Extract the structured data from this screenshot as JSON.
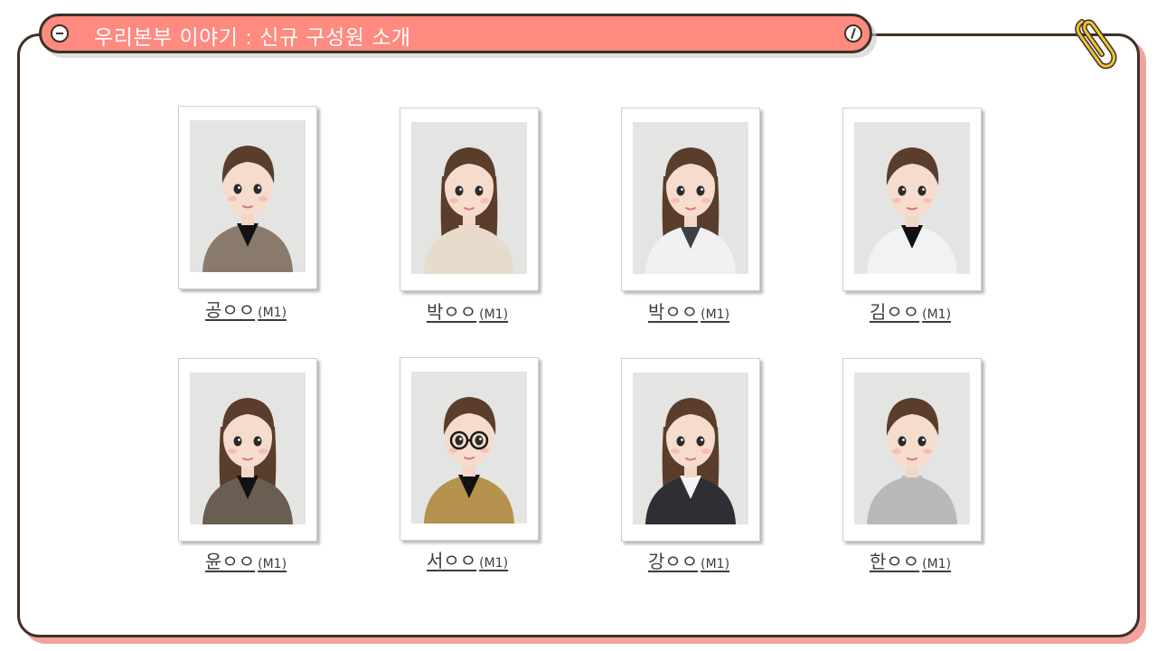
{
  "title": "우리본부 이야기 : 신규 구성원 소개",
  "members": [
    {
      "name": "공ㅇㅇ",
      "tag": "(M1)",
      "hair": "#5a3d2b",
      "top": "#8a7a6c",
      "inner": "#111111"
    },
    {
      "name": "박ㅇㅇ",
      "tag": "(M1)",
      "hair": "#5a3d2b",
      "top": "#e7dccc",
      "inner": "#e7dccc"
    },
    {
      "name": "박ㅇㅇ",
      "tag": "(M1)",
      "hair": "#5a3d2b",
      "top": "#f1f1f4",
      "inner": "#3f3f44"
    },
    {
      "name": "김ㅇㅇ",
      "tag": "(M1)",
      "hair": "#5a3d2b",
      "top": "#f2f2f2",
      "inner": "#111111"
    },
    {
      "name": "윤ㅇㅇ",
      "tag": "(M1)",
      "hair": "#5a3d2b",
      "top": "#6a5d52",
      "inner": "#111111"
    },
    {
      "name": "서ㅇㅇ",
      "tag": "(M1)",
      "hair": "#5a3d2b",
      "top": "#b5924d",
      "inner": "#111111"
    },
    {
      "name": "강ㅇㅇ",
      "tag": "(M1)",
      "hair": "#5a3d2b",
      "top": "#2e2e34",
      "inner": "#f5f5f5"
    },
    {
      "name": "한ㅇㅇ",
      "tag": "(M1)",
      "hair": "#5a3d2b",
      "top": "#b9b9bb",
      "inner": "#b9b9bb"
    }
  ]
}
